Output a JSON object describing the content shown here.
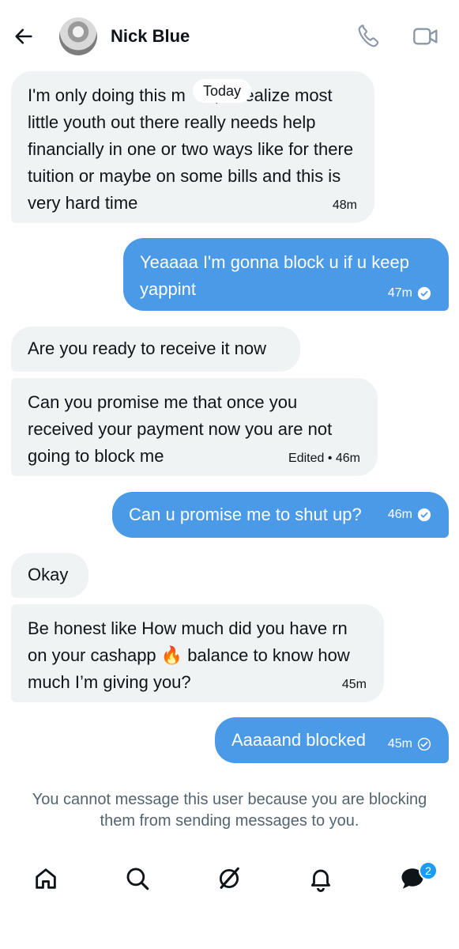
{
  "header": {
    "contact_name": "Nick Blue",
    "back_icon": "arrow-left-icon",
    "call_icon": "phone-icon",
    "video_icon": "video-camera-icon"
  },
  "date_divider": "Today",
  "messages": [
    {
      "direction": "incoming",
      "text": "I'm only doing this m      ,  I realize most little youth out there really needs help financially in one or two ways like for there tuition or maybe on some bills and this is very hard time",
      "time": "48m"
    },
    {
      "direction": "outgoing",
      "text": "Yeaaaa I'm gonna block u if u keep yappint",
      "time": "47m",
      "status": "seen"
    },
    {
      "direction": "incoming",
      "text": "Are you ready to receive it now",
      "time": ""
    },
    {
      "direction": "incoming",
      "text": "Can you promise me that once you received your payment now you are not going to block me",
      "time": "Edited • 46m"
    },
    {
      "direction": "outgoing",
      "text": "Can u promise me to shut up?",
      "time": "46m",
      "status": "seen"
    },
    {
      "direction": "incoming",
      "text": "Okay",
      "time": ""
    },
    {
      "direction": "incoming",
      "text": "Be honest like How much did you have rn on your cashapp 🔥 balance to know how much I’m giving you?",
      "time": "45m"
    },
    {
      "direction": "outgoing",
      "text": "Aaaaand blocked",
      "time": "45m",
      "status": "sent"
    }
  ],
  "blocked_notice": "You cannot message this user because you are blocking them from sending messages to you.",
  "nav": {
    "items": [
      "home-icon",
      "search-icon",
      "grok-icon",
      "notifications-icon",
      "messages-icon"
    ],
    "messages_badge": "2"
  },
  "colors": {
    "outgoing_bubble": "#4a9ae8",
    "incoming_bubble": "#eff3f4",
    "badge": "#1d9bf0",
    "notice_text": "#536471"
  }
}
